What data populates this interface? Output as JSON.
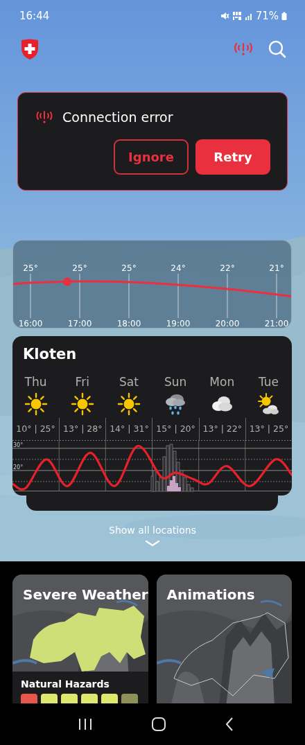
{
  "status_bar": {
    "time": "16:44",
    "battery": "71%"
  },
  "dialog": {
    "message": "Connection error",
    "buttons": [
      {
        "label": "Ignore",
        "kind": "outline"
      },
      {
        "label": "Retry",
        "kind": "filled"
      }
    ]
  },
  "hourly": [
    {
      "time": "16:00",
      "temp": "25°"
    },
    {
      "time": "17:00",
      "temp": "25°"
    },
    {
      "time": "18:00",
      "temp": "25°"
    },
    {
      "time": "19:00",
      "temp": "24°"
    },
    {
      "time": "20:00",
      "temp": "22°"
    },
    {
      "time": "21:00",
      "temp": "21°"
    }
  ],
  "forecast": {
    "location": "Kloten",
    "days": [
      {
        "day": "Thu",
        "kind": "sun",
        "temps": "10° | 25°"
      },
      {
        "day": "Fri",
        "kind": "sun",
        "temps": "13° | 28°"
      },
      {
        "day": "Sat",
        "kind": "sun",
        "temps": "14° | 31°"
      },
      {
        "day": "Sun",
        "kind": "rain",
        "temps": "15° | 20°"
      },
      {
        "day": "Mon",
        "kind": "cloud",
        "temps": "13° | 22°"
      },
      {
        "day": "Tue",
        "kind": "partly-sunny",
        "temps": "13° | 25°"
      }
    ],
    "scale_labels": [
      "30°",
      "20°"
    ]
  },
  "show_all": {
    "label": "Show all locations"
  },
  "tiles": [
    {
      "title": "Severe Weather",
      "kind": "hazards",
      "subtitle": "Natural Hazards",
      "hazards": [
        {
          "color": "#e8574b"
        },
        {
          "color": "#dde86c"
        },
        {
          "color": "#dde86c"
        },
        {
          "color": "#dde86c"
        },
        {
          "color": "#dde86c"
        },
        {
          "color": "#8f9256"
        }
      ]
    },
    {
      "title": "Animations",
      "kind": "map"
    }
  ]
}
